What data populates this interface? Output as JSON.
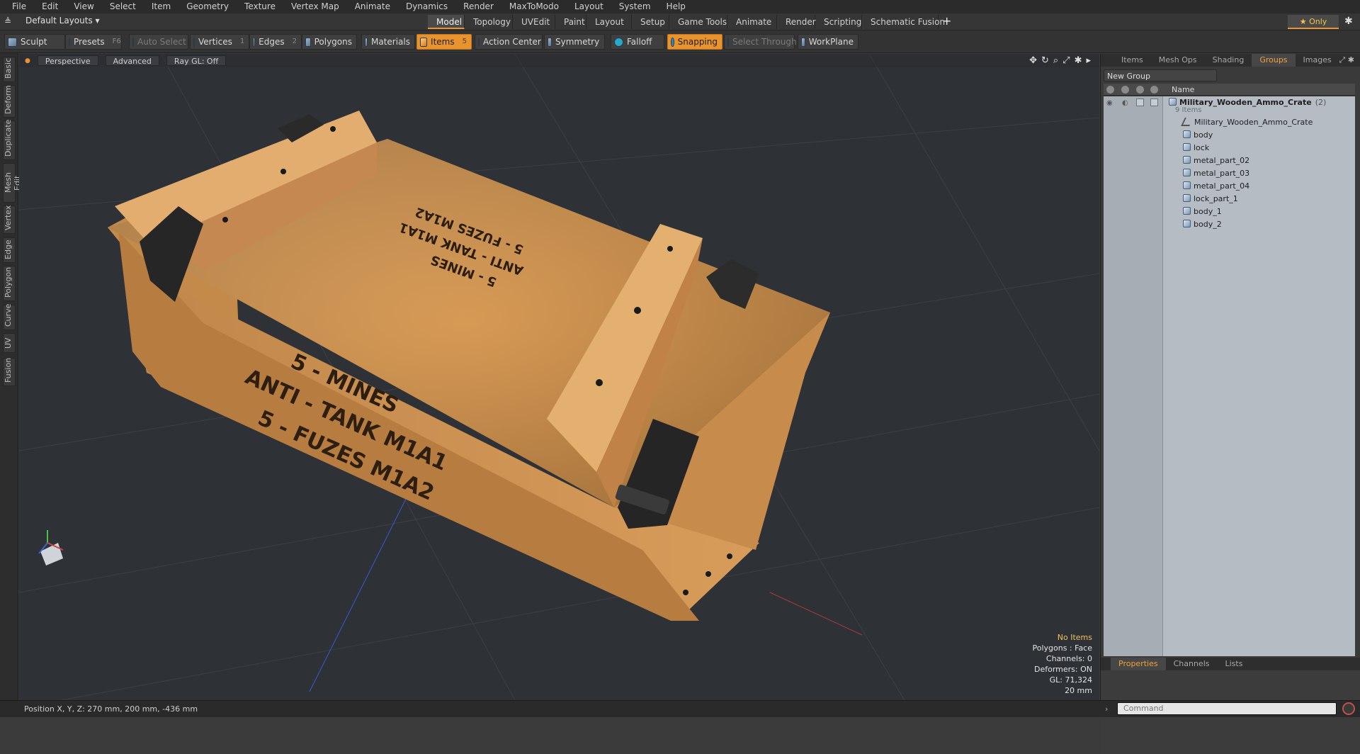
{
  "menu": [
    "File",
    "Edit",
    "View",
    "Select",
    "Item",
    "Geometry",
    "Texture",
    "Vertex Map",
    "Animate",
    "Dynamics",
    "Render",
    "MaxToModo",
    "Layout",
    "System",
    "Help"
  ],
  "layout_selector": "Default Layouts ▾",
  "layout_tabs": [
    "Model",
    "Topology",
    "UVEdit",
    "Paint",
    "Layout",
    "Setup",
    "Game Tools",
    "Animate",
    "Render",
    "Scripting",
    "Schematic Fusion"
  ],
  "active_layout_tab": "Model",
  "add_tab": "+",
  "only_label": "★ Only",
  "toolbar": {
    "sculpt": "Sculpt",
    "presets": "Presets",
    "presets_key": "F6",
    "auto_select": "Auto Select",
    "vertices": "Vertices",
    "vertices_key": "1",
    "edges": "Edges",
    "edges_key": "2",
    "polygons": "Polygons",
    "materials": "Materials",
    "items": "Items",
    "items_key": "5",
    "action_center": "Action Center",
    "symmetry": "Symmetry",
    "falloff": "Falloff",
    "snapping": "Snapping",
    "select_through": "Select Through",
    "workplane": "WorkPlane"
  },
  "left_tabs": [
    "Basic",
    "Deform",
    "Duplicate",
    "Mesh Edit",
    "Vertex",
    "Edge",
    "Polygon",
    "Curve",
    "UV",
    "Fusion"
  ],
  "viewport": {
    "view": "Perspective",
    "shading": "Advanced",
    "raygl": "Ray GL: Off",
    "crate_text_lid": [
      "5 - MINES",
      "ANTI - TANK M1A1",
      "5 - FUZES M1A2"
    ],
    "crate_text_side": [
      "5 - MINES",
      "ANTI - TANK M1A1",
      "5 - FUZES M1A2"
    ],
    "hud": {
      "items": "No Items",
      "polygons": "Polygons : Face",
      "channels": "Channels: 0",
      "deformers": "Deformers: ON",
      "gl": "GL: 71,324",
      "scale": "20 mm"
    }
  },
  "right_panel": {
    "tabs": [
      "Items",
      "Mesh Ops",
      "Shading",
      "Groups",
      "Images"
    ],
    "active_tab": "Groups",
    "new_group": "New Group",
    "name_header": "Name",
    "group": {
      "name": "Military_Wooden_Ammo_Crate",
      "count": "(2)",
      "subtitle": "9 Items",
      "children": [
        "Military_Wooden_Ammo_Crate",
        "body",
        "lock",
        "metal_part_02",
        "metal_part_03",
        "metal_part_04",
        "lock_part_1",
        "body_1",
        "body_2"
      ]
    },
    "prop_tabs": [
      "Properties",
      "Channels",
      "Lists"
    ],
    "active_prop_tab": "Properties"
  },
  "status": {
    "position": "Position X, Y, Z:   270 mm, 200 mm, -436 mm",
    "command_placeholder": "Command"
  },
  "colors": {
    "accent": "#e8932d",
    "viewport_bg": "#2e3237",
    "tree_bg": "#b6bcc4"
  }
}
